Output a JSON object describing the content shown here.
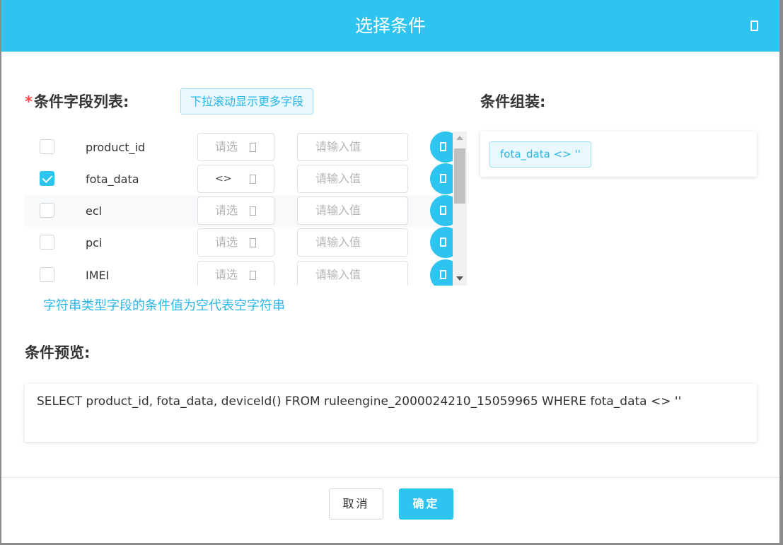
{
  "dialog": {
    "title": "选择条件",
    "close_icon": "close-icon"
  },
  "fields_section": {
    "required_mark": "*",
    "title": "条件字段列表:",
    "hint": "下拉滚动显示更多字段",
    "note": "字符串类型字段的条件值为空代表空字符串",
    "rows": [
      {
        "name": "product_id",
        "checked": false,
        "operator": "请选",
        "value_placeholder": "请输入值"
      },
      {
        "name": "fota_data",
        "checked": true,
        "operator": "<>",
        "value_placeholder": "请输入值"
      },
      {
        "name": "ecl",
        "checked": false,
        "operator": "请选",
        "value_placeholder": "请输入值"
      },
      {
        "name": "pci",
        "checked": false,
        "operator": "请选",
        "value_placeholder": "请输入值"
      },
      {
        "name": "IMEI",
        "checked": false,
        "operator": "请选",
        "value_placeholder": "请输入值"
      }
    ]
  },
  "assembly_section": {
    "title": "条件组装:",
    "conditions": [
      "fota_data <> ''"
    ]
  },
  "preview_section": {
    "title": "条件预览:",
    "sql": "SELECT product_id, fota_data, deviceId() FROM ruleengine_2000024210_15059965 WHERE fota_data <> ''"
  },
  "footer": {
    "cancel_label": "取消",
    "ok_label": "确定"
  },
  "colors": {
    "accent": "#2ec4f0",
    "required": "#f04b4b"
  }
}
